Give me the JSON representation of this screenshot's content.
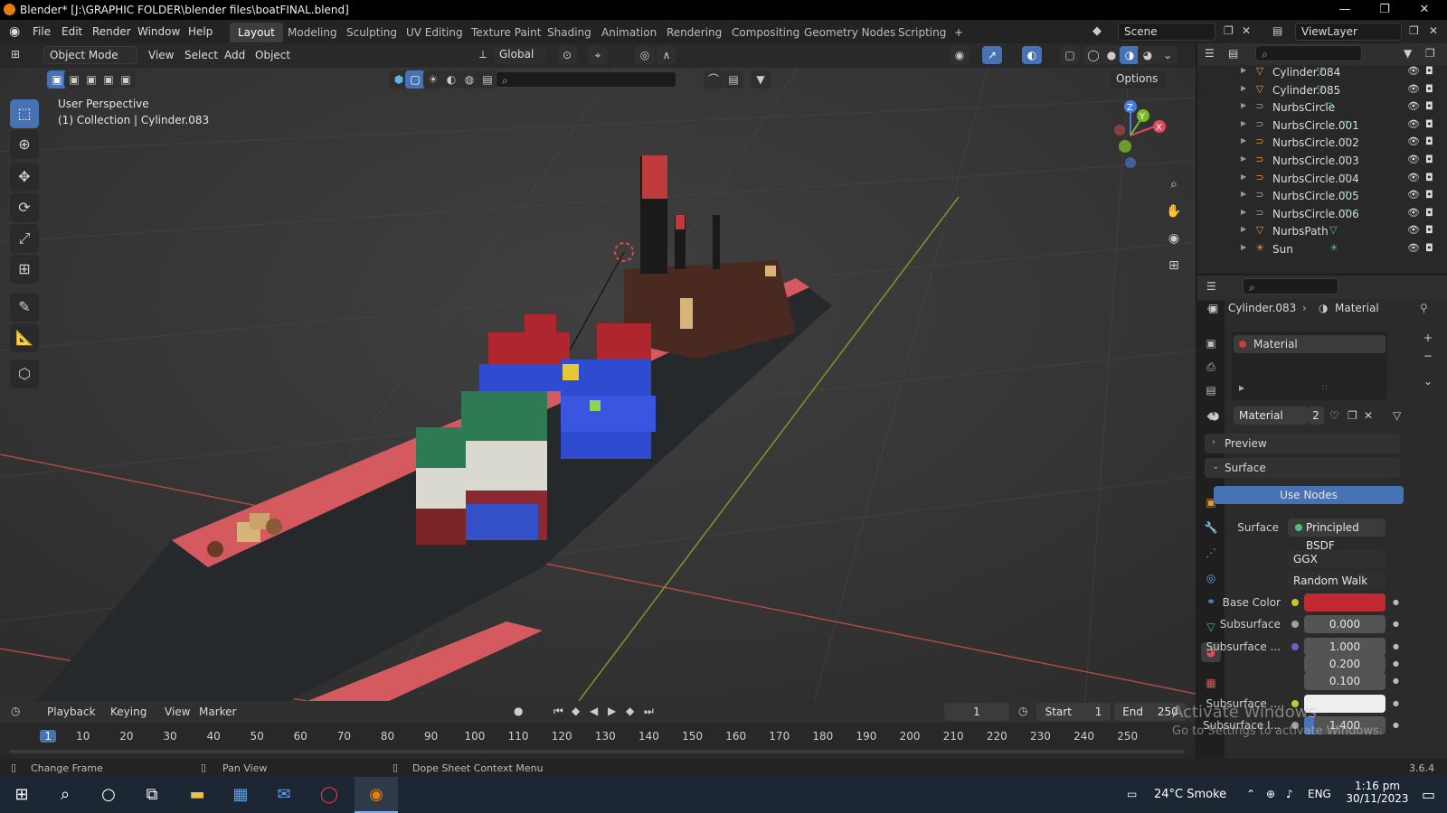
{
  "app": {
    "title": "Blender* [J:\\GRAPHIC FOLDER\\blender files\\boatFINAL.blend]",
    "version": "3.6.4"
  },
  "window_controls": {
    "minimize": "—",
    "maximize": "❐",
    "close": "✕"
  },
  "menu": {
    "items": [
      "File",
      "Edit",
      "Render",
      "Window",
      "Help"
    ]
  },
  "workspaces": {
    "tabs": [
      "Layout",
      "Modeling",
      "Sculpting",
      "UV Editing",
      "Texture Paint",
      "Shading",
      "Animation",
      "Rendering",
      "Compositing",
      "Geometry Nodes",
      "Scripting"
    ],
    "active": "Layout",
    "add": "+"
  },
  "scene": {
    "name": "Scene",
    "view_layer": "ViewLayer"
  },
  "viewport": {
    "mode": "Object Mode",
    "menus": [
      "View",
      "Select",
      "Add",
      "Object"
    ],
    "orientation": "Global",
    "options": "Options",
    "overlay_line1": "User Perspective",
    "overlay_line2": "(1) Collection | Cylinder.083",
    "gizmo_axes": [
      "X",
      "Y",
      "Z"
    ]
  },
  "outliner": {
    "items": [
      {
        "name": "Cylinder.084",
        "type": "mesh"
      },
      {
        "name": "Cylinder.085",
        "type": "mesh"
      },
      {
        "name": "NurbsCircle",
        "type": "curve"
      },
      {
        "name": "NurbsCircle.001",
        "type": "curve"
      },
      {
        "name": "NurbsCircle.002",
        "type": "curve"
      },
      {
        "name": "NurbsCircle.003",
        "type": "curve"
      },
      {
        "name": "NurbsCircle.004",
        "type": "curve"
      },
      {
        "name": "NurbsCircle.005",
        "type": "curve"
      },
      {
        "name": "NurbsCircle.006",
        "type": "curve"
      },
      {
        "name": "NurbsPath",
        "type": "mesh"
      },
      {
        "name": "Sun",
        "type": "light"
      }
    ]
  },
  "properties": {
    "breadcrumb_object": "Cylinder.083",
    "breadcrumb_sep": "›",
    "breadcrumb_tab": "Material",
    "slot_name": "Material",
    "material_name": "Material",
    "material_users": "2",
    "panels": {
      "preview": "Preview",
      "surface": "Surface"
    },
    "use_nodes": "Use Nodes",
    "surface_label": "Surface",
    "surface_value": "Principled BSDF",
    "distribution": "GGX",
    "subsurface_method": "Random Walk",
    "fields": [
      {
        "label": "Base Color",
        "value": "",
        "dot": "yellow"
      },
      {
        "label": "Subsurface",
        "value": "0.000",
        "dot": "gray"
      },
      {
        "label": "Subsurface ...",
        "value": "1.000",
        "dot": "purple"
      },
      {
        "label": "",
        "value": "0.200",
        "dot": ""
      },
      {
        "label": "",
        "value": "0.100",
        "dot": ""
      },
      {
        "label": "Subsurface ...",
        "value": "",
        "dot": "yellow"
      },
      {
        "label": "Subsurface I...",
        "value": "1.400",
        "dot": "gray"
      }
    ],
    "base_color": "#c0292f",
    "accent": "#4772b3"
  },
  "timeline": {
    "menus": [
      "Playback",
      "Keying",
      "View",
      "Marker"
    ],
    "current_frame": "1",
    "start_label": "Start",
    "start": "1",
    "end_label": "End",
    "end": "250",
    "ticks": [
      "1",
      "10",
      "20",
      "30",
      "40",
      "50",
      "60",
      "70",
      "80",
      "90",
      "100",
      "110",
      "120",
      "130",
      "140",
      "150",
      "160",
      "170",
      "180",
      "190",
      "200",
      "210",
      "220",
      "230",
      "240",
      "250"
    ]
  },
  "statusbar": {
    "left": "Change Frame",
    "middle": "Pan View",
    "right": "Dope Sheet Context Menu"
  },
  "watermark": {
    "line1": "Activate Windows",
    "line2": "Go to Settings to activate Windows."
  },
  "taskbar": {
    "weather": "24°C  Smoke",
    "lang": "ENG",
    "time": "1:16 pm",
    "date": "30/11/2023"
  }
}
